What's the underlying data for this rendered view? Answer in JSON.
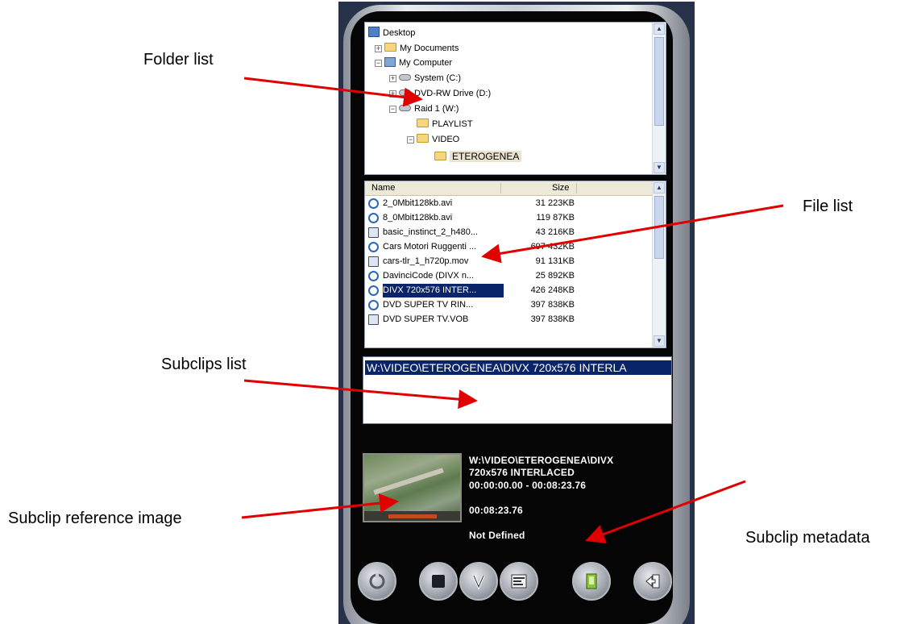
{
  "annotations": {
    "folder_list": "Folder list",
    "file_list": "File list",
    "subclips_list": "Subclips list",
    "subclip_reference_image": "Subclip reference image",
    "subclip_metadata": "Subclip metadata"
  },
  "folder_tree": {
    "items": [
      {
        "label": "Desktop"
      },
      {
        "label": "My Documents"
      },
      {
        "label": "My Computer"
      },
      {
        "label": "System (C:)"
      },
      {
        "label": "DVD-RW Drive (D:)"
      },
      {
        "label": "Raid 1 (W:)"
      },
      {
        "label": "PLAYLIST"
      },
      {
        "label": "VIDEO"
      },
      {
        "label": "ETEROGENEA"
      }
    ]
  },
  "file_list": {
    "columns": {
      "name": "Name",
      "size": "Size"
    },
    "rows": [
      {
        "name": "2_0Mbit128kb.avi",
        "size": "31 223KB"
      },
      {
        "name": "8_0Mbit128kb.avi",
        "size": "119 87KB"
      },
      {
        "name": "basic_instinct_2_h480...",
        "size": "43 216KB"
      },
      {
        "name": "Cars Motori Ruggenti ...",
        "size": "697 432KB"
      },
      {
        "name": "cars-tlr_1_h720p.mov",
        "size": "91 131KB"
      },
      {
        "name": "DavinciCode (DIVX n...",
        "size": "25 892KB"
      },
      {
        "name": "DIVX 720x576 INTER...",
        "size": "426 248KB"
      },
      {
        "name": "DVD SUPER TV RIN...",
        "size": "397 838KB"
      },
      {
        "name": "DVD SUPER TV.VOB",
        "size": "397 838KB"
      }
    ]
  },
  "subclips": {
    "items": [
      "W:\\VIDEO\\ETEROGENEA\\DIVX 720x576 INTERLA"
    ]
  },
  "metadata": {
    "path_line1": "W:\\VIDEO\\ETEROGENEA\\DIVX",
    "path_line2": "720x576 INTERLACED",
    "range": "00:00:00.00 - 00:08:23.76",
    "duration": "00:08:23.76",
    "status": "Not Defined"
  },
  "buttons": [
    {
      "icon": "refresh-icon"
    },
    {
      "icon": "stop-icon"
    },
    {
      "icon": "edit-icon"
    },
    {
      "icon": "list-icon"
    },
    {
      "icon": "export-icon"
    },
    {
      "icon": "exit-icon"
    }
  ],
  "colors": {
    "selection": "#0a246a",
    "arrow": "#e00000",
    "device_body": "#050505"
  }
}
